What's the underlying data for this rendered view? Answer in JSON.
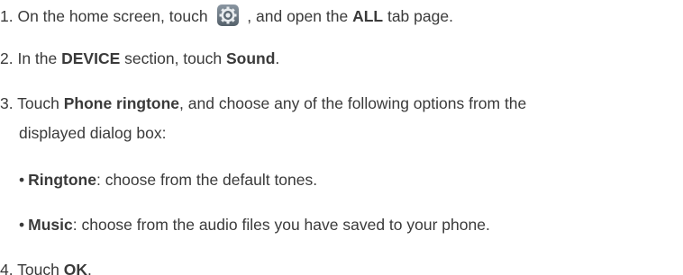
{
  "steps": {
    "s1": {
      "prefix": "1. On the home screen, touch ",
      "mid": " , and open the ",
      "bold1": "ALL",
      "suffix": " tab page.",
      "icon": "settings-gear-icon"
    },
    "s2": {
      "prefix": "2. In the ",
      "bold1": "DEVICE",
      "mid": " section, touch ",
      "bold2": "Sound",
      "suffix": "."
    },
    "s3": {
      "prefix": "3. Touch ",
      "bold1": "Phone ringtone",
      "suffix": ", and choose any of the following options from the",
      "cont": "displayed dialog box:"
    },
    "b1": {
      "bullet": "•",
      "bold1": "Ringtone",
      "suffix": ": choose from the default tones."
    },
    "b2": {
      "bullet": "•",
      "bold1": "Music",
      "suffix": ": choose from the audio files you have saved to your phone."
    },
    "s4": {
      "prefix": "4. Touch ",
      "bold1": "OK",
      "suffix": "."
    }
  },
  "colors": {
    "text": "#3a3a3a",
    "icon_bg": "#6f7b86"
  }
}
